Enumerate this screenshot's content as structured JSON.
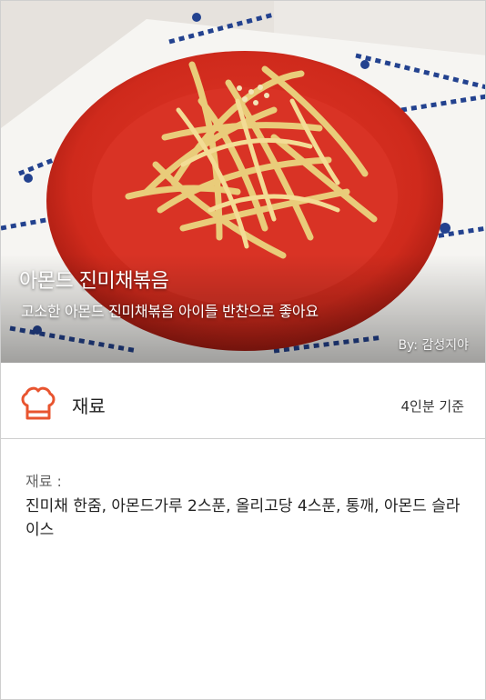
{
  "hero": {
    "title": "아몬드 진미채볶음",
    "subtitle": "고소한 아몬드 진미채볶음 아이들 반찬으로 좋아요",
    "credit": "By: 감성지야",
    "image_icon": "food-photo"
  },
  "section": {
    "icon": "chef-hat-icon",
    "title": "재료",
    "serving": "4인분 기준"
  },
  "ingredients": {
    "label": "재료 :",
    "text": "진미채 한줌, 아몬드가루 2스푼, 올리고당 4스푼, 통깨, 아몬드 슬라이스"
  },
  "colors": {
    "accent": "#e8542f",
    "divider": "#cfcfcf",
    "plate": "#d42a1e"
  }
}
